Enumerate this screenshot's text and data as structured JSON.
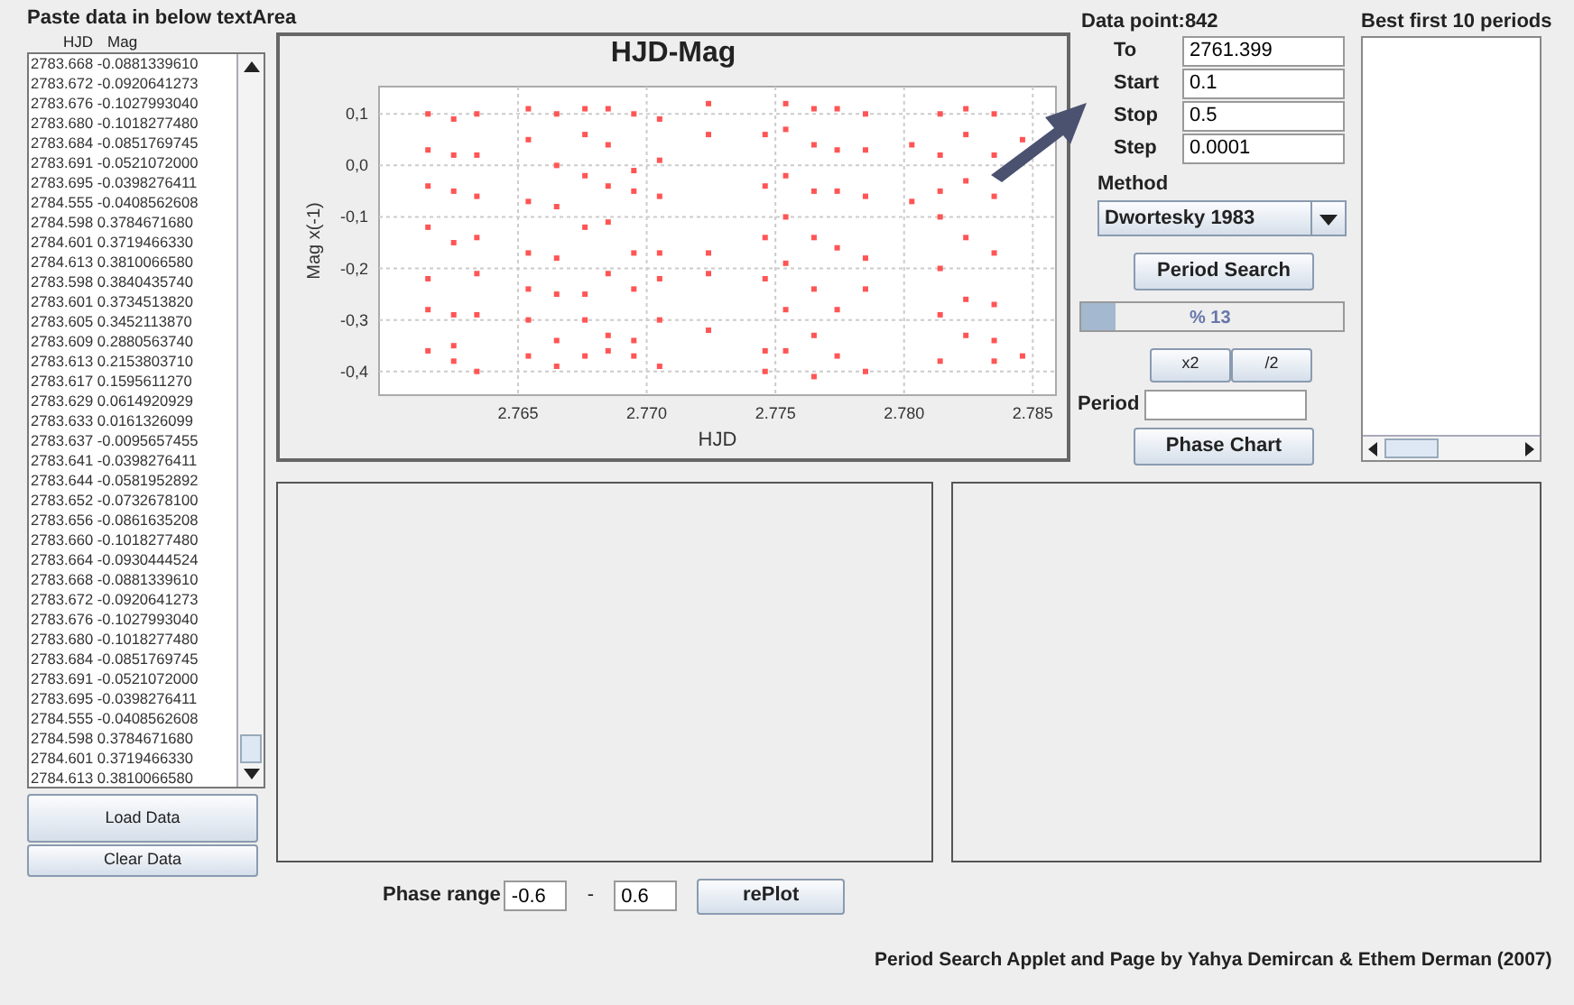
{
  "data_panel": {
    "title": "Paste data in below textArea",
    "headers": [
      "HJD",
      "Mag"
    ],
    "lines": [
      "2783.668 -0.0881339610",
      "2783.672 -0.0920641273",
      "2783.676 -0.1027993040",
      "2783.680 -0.1018277480",
      "2783.684 -0.0851769745",
      "2783.691 -0.0521072000",
      "2783.695 -0.0398276411",
      "2784.555 -0.0408562608",
      "2784.598 0.3784671680",
      "2784.601 0.3719466330",
      "2784.613 0.3810066580",
      "2783.598 0.3840435740",
      "2783.601 0.3734513820",
      "2783.605 0.3452113870",
      "2783.609 0.2880563740",
      "2783.613 0.2153803710",
      "2783.617 0.1595611270",
      "2783.629 0.0614920929",
      "2783.633 0.0161326099",
      "2783.637 -0.0095657455",
      "2783.641 -0.0398276411",
      "2783.644 -0.0581952892",
      "2783.652 -0.0732678100",
      "2783.656 -0.0861635208",
      "2783.660 -0.1018277480",
      "2783.664 -0.0930444524",
      "2783.668 -0.0881339610",
      "2783.672 -0.0920641273",
      "2783.676 -0.1027993040",
      "2783.680 -0.1018277480",
      "2783.684 -0.0851769745",
      "2783.691 -0.0521072000",
      "2783.695 -0.0398276411",
      "2784.555 -0.0408562608",
      "2784.598 0.3784671680",
      "2784.601 0.3719466330",
      "2784.613 0.3810066580"
    ],
    "buttons": [
      "Load Data",
      "Clear Data"
    ]
  },
  "chart": {
    "chart_data": {
      "type": "scatter",
      "grid": true,
      "title": "HJD-Mag",
      "xlabel": "HJD",
      "ylabel": "Mag x(-1)",
      "xlim": [
        2.7596,
        2.7859
      ],
      "ylim": [
        -0.446,
        0.153
      ],
      "xticks": [
        {
          "value": 2.765,
          "label": "2.765"
        },
        {
          "value": 2.77,
          "label": "2.770"
        },
        {
          "value": 2.775,
          "label": "2.775"
        },
        {
          "value": 2.78,
          "label": "2.780"
        },
        {
          "value": 2.785,
          "label": "2.785"
        }
      ],
      "yticks": [
        {
          "value": 0.1,
          "label": "0,1"
        },
        {
          "value": 0,
          "label": "0,0"
        },
        {
          "value": -0.1,
          "label": "-0,1"
        },
        {
          "value": -0.2,
          "label": "-0,2"
        },
        {
          "value": -0.3,
          "label": "-0,3"
        },
        {
          "value": -0.4,
          "label": "-0,4"
        }
      ],
      "x": [
        2.7615,
        2.7615,
        2.7615,
        2.7615,
        2.7615,
        2.7615,
        2.7615,
        2.7625,
        2.7625,
        2.7625,
        2.7625,
        2.7625,
        2.7625,
        2.7625,
        2.7634,
        2.7634,
        2.7634,
        2.7634,
        2.7634,
        2.7634,
        2.7634,
        2.7654,
        2.7654,
        2.7654,
        2.7654,
        2.7654,
        2.7654,
        2.7654,
        2.7665,
        2.7665,
        2.7665,
        2.7665,
        2.7665,
        2.7665,
        2.7665,
        2.7676,
        2.7676,
        2.7676,
        2.7676,
        2.7676,
        2.7676,
        2.7676,
        2.7685,
        2.7685,
        2.7685,
        2.7685,
        2.7685,
        2.7685,
        2.7685,
        2.7695,
        2.7695,
        2.7695,
        2.7695,
        2.7695,
        2.7695,
        2.7695,
        2.7705,
        2.7705,
        2.7705,
        2.7705,
        2.7705,
        2.7705,
        2.7705,
        2.7724,
        2.7724,
        2.7724,
        2.7724,
        2.7724,
        2.7746,
        2.7746,
        2.7746,
        2.7746,
        2.7746,
        2.7746,
        2.7754,
        2.7754,
        2.7754,
        2.7754,
        2.7754,
        2.7754,
        2.7754,
        2.7765,
        2.7765,
        2.7765,
        2.7765,
        2.7765,
        2.7765,
        2.7765,
        2.7774,
        2.7774,
        2.7774,
        2.7774,
        2.7774,
        2.7774,
        2.7785,
        2.7785,
        2.7785,
        2.7785,
        2.7785,
        2.7785,
        2.7803,
        2.7803,
        2.7814,
        2.7814,
        2.7814,
        2.7814,
        2.7814,
        2.7814,
        2.7814,
        2.7824,
        2.7824,
        2.7824,
        2.7824,
        2.7824,
        2.7824,
        2.7835,
        2.7835,
        2.7835,
        2.7835,
        2.7835,
        2.7835,
        2.7835,
        2.7846,
        2.7846
      ],
      "series": [
        {
          "color": "#ff5555",
          "values": [
            0.1,
            0.03,
            -0.04,
            -0.12,
            -0.22,
            -0.28,
            -0.36,
            0.09,
            0.02,
            -0.05,
            -0.15,
            -0.29,
            -0.35,
            -0.38,
            0.1,
            0.02,
            -0.06,
            -0.14,
            -0.21,
            -0.29,
            -0.4,
            0.11,
            0.05,
            -0.07,
            -0.17,
            -0.24,
            -0.3,
            -0.37,
            0.1,
            0.0,
            -0.08,
            -0.18,
            -0.25,
            -0.34,
            -0.39,
            0.11,
            0.06,
            -0.02,
            -0.12,
            -0.25,
            -0.3,
            -0.37,
            0.11,
            0.04,
            -0.04,
            -0.11,
            -0.21,
            -0.33,
            -0.36,
            0.1,
            -0.01,
            -0.05,
            -0.17,
            -0.24,
            -0.34,
            -0.37,
            0.09,
            0.01,
            -0.06,
            -0.17,
            -0.22,
            -0.3,
            -0.39,
            0.12,
            0.06,
            -0.17,
            -0.21,
            -0.32,
            0.06,
            -0.04,
            -0.14,
            -0.22,
            -0.36,
            -0.4,
            0.12,
            0.07,
            -0.02,
            -0.1,
            -0.19,
            -0.28,
            -0.36,
            0.11,
            0.04,
            -0.05,
            -0.14,
            -0.24,
            -0.33,
            -0.41,
            0.11,
            0.03,
            -0.05,
            -0.16,
            -0.28,
            -0.37,
            0.1,
            0.03,
            -0.06,
            -0.18,
            -0.24,
            -0.4,
            0.04,
            -0.07,
            0.1,
            0.02,
            -0.05,
            -0.1,
            -0.2,
            -0.29,
            -0.38,
            0.11,
            0.06,
            -0.03,
            -0.14,
            -0.26,
            -0.33,
            0.1,
            0.02,
            -0.06,
            -0.17,
            -0.27,
            -0.34,
            -0.38,
            0.05,
            -0.37
          ]
        }
      ]
    }
  },
  "controls": {
    "data_point": "Data point:842",
    "fields": [
      {
        "label": "To",
        "value": "2761.399"
      },
      {
        "label": "Start",
        "value": "0.1"
      },
      {
        "label": "Stop",
        "value": "0.5"
      },
      {
        "label": "Step",
        "value": "0.0001"
      }
    ],
    "method_label": "Method",
    "method": "Dwortesky 1983",
    "search_button": "Period Search",
    "progress": {
      "level": 0.13,
      "reading": "% 13"
    },
    "multiply_buttons": [
      "x2",
      "/2"
    ],
    "period_label": "Period",
    "phase_chart_button": "Phase Chart"
  },
  "periods_panel": {
    "title": "Best first 10 periods"
  },
  "phase_range": {
    "label": "Phase range",
    "from": "-0.6",
    "separator": "-",
    "to": "0.6",
    "button": "rePlot"
  },
  "footer": "Period Search Applet and Page by Yahya Demircan & Ethem Derman (2007)"
}
